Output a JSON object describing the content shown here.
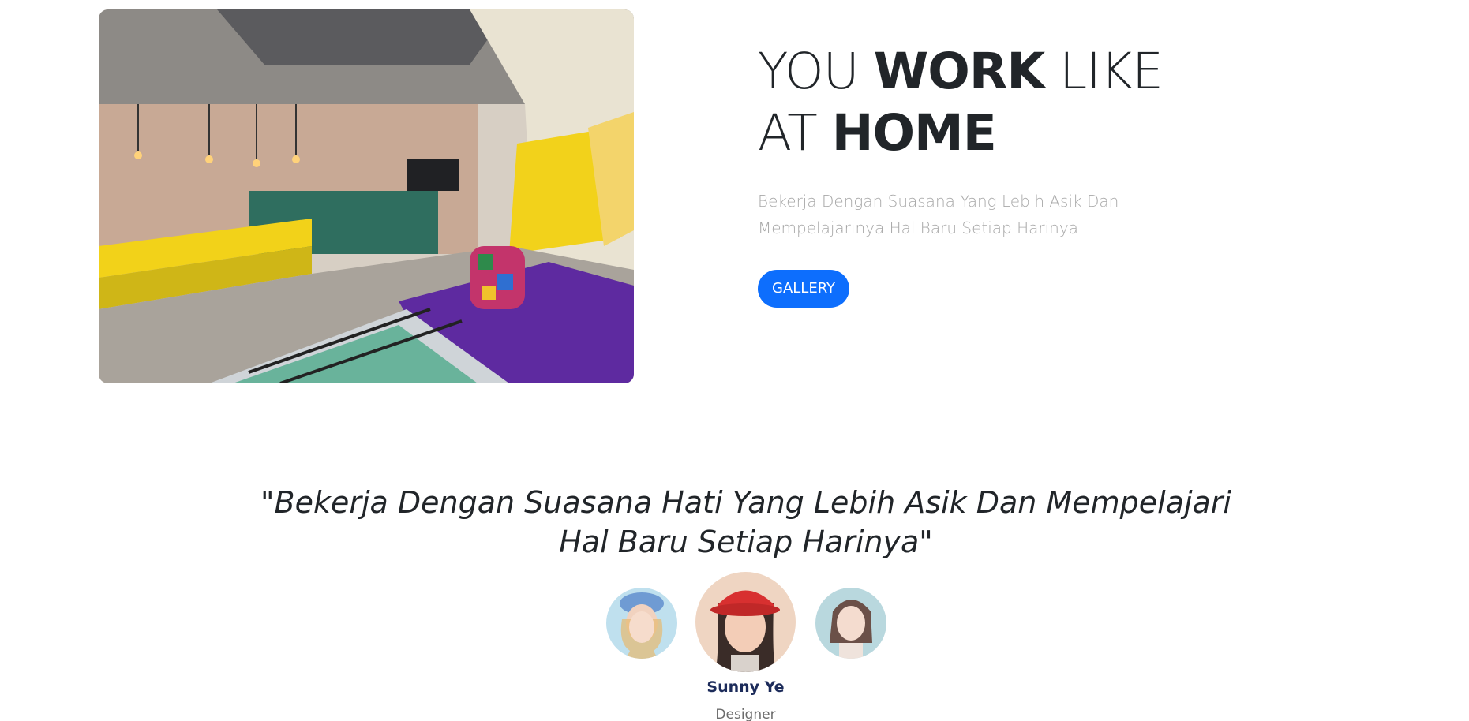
{
  "hero": {
    "image_icon": "office-lounge-photo",
    "title_part1": "YOU ",
    "title_bold1": "WORK",
    "title_part2": " LIKE",
    "title_part3": "AT ",
    "title_bold2": "HOME",
    "subtitle": "Bekerja Dengan Suasana Yang Lebih Asik Dan Mempelajarinya Hal Baru Setiap Harinya",
    "button_label": "GALLERY"
  },
  "testimonial": {
    "quote": "\"Bekerja Dengan Suasana Hati Yang Lebih Asik Dan Mempelajari Hal Baru Setiap Harinya\"",
    "avatars": [
      {
        "icon": "avatar-photo-left"
      },
      {
        "icon": "avatar-photo-center"
      },
      {
        "icon": "avatar-photo-right"
      }
    ],
    "name": "Sunny Ye",
    "role": "Designer"
  },
  "colors": {
    "accent": "#0d6efd",
    "name_color": "#1c2b5a",
    "subtitle_color": "#a8a8a8"
  }
}
